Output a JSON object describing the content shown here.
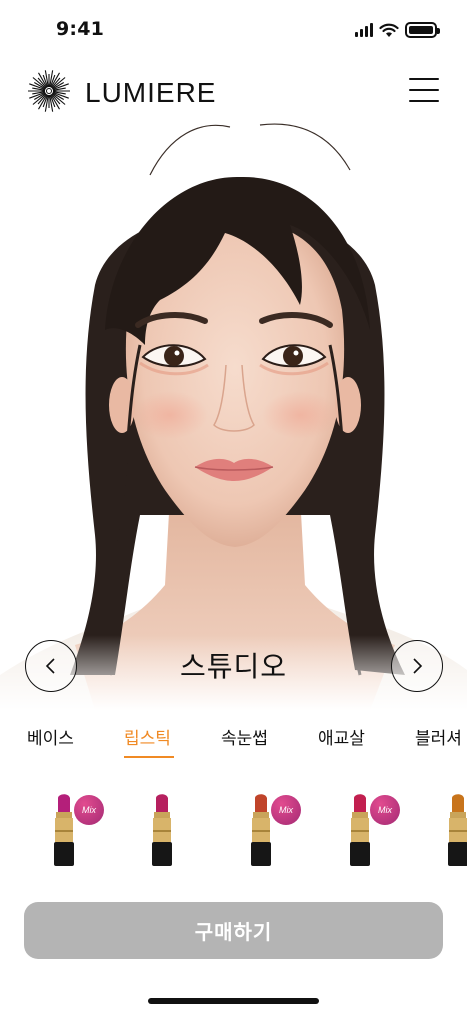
{
  "status_bar": {
    "time": "9:41"
  },
  "header": {
    "brand": "LUMIERE"
  },
  "look": {
    "name": "스튜디오"
  },
  "tabs": [
    {
      "label": "베이스"
    },
    {
      "label": "립스틱",
      "active": true
    },
    {
      "label": "속눈썹"
    },
    {
      "label": "애교살"
    },
    {
      "label": "블러셔"
    }
  ],
  "products": [
    {
      "color": "#b41f7a",
      "mix": true,
      "mix_label": "Mix"
    },
    {
      "color": "#b6205f",
      "mix": false
    },
    {
      "color": "#c0442a",
      "mix": true,
      "mix_label": "Mix"
    },
    {
      "color": "#c21f4f",
      "mix": true,
      "mix_label": "Mix"
    },
    {
      "color": "#c8741c",
      "mix": false
    }
  ],
  "purchase": {
    "label": "구매하기"
  },
  "colors": {
    "accent": "#f08a24",
    "button_disabled": "#b4b4b4"
  }
}
